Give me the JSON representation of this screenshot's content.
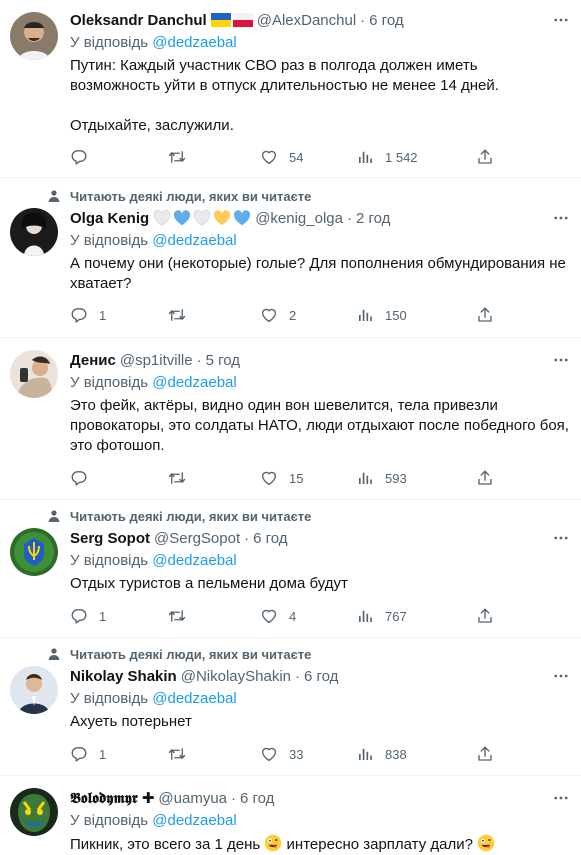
{
  "colors": {
    "accent": "#1d9bf0",
    "muted": "#536471",
    "text": "#0f1419",
    "divider": "#eff3f4"
  },
  "tweets": [
    {
      "name": "Oleksandr Danchul",
      "handle": "@AlexDanchul",
      "dot": "·",
      "time": "6 год",
      "reply_prefix": "У відповідь",
      "reply_to": "@dedzaebal",
      "text_lines": [
        "Путин: Каждый участник СВО раз в полгода должен иметь возможность уйти в отпуск длительностью не менее 14 дней.",
        "Отдыхайте, заслужили."
      ],
      "replies": "",
      "retweets": "",
      "likes": "54",
      "views": "1 542",
      "flair": [
        "ukraine-flag-icon",
        "poland-flag-icon"
      ]
    },
    {
      "social_context": "Читають деякі люди, яких ви читаєте",
      "name": "Olga Kenig",
      "handle": "@kenig_olga",
      "dot": "·",
      "time": "2 год",
      "reply_prefix": "У відповідь",
      "reply_to": "@dedzaebal",
      "text_lines": [
        "А почему они (некоторые) голые? Для пополнения обмундирования не хватает?"
      ],
      "replies": "1",
      "retweets": "",
      "likes": "2",
      "views": "150",
      "flair": [
        "white-heart-icon",
        "blue-heart-icon",
        "white-heart-icon",
        "yellow-heart-icon",
        "blue-heart-icon"
      ]
    },
    {
      "name": "Денис",
      "handle": "@sp1itville",
      "dot": "·",
      "time": "5 год",
      "reply_prefix": "У відповідь",
      "reply_to": "@dedzaebal",
      "text_lines": [
        "Это фейк, актёры, видно один вон шевелится, тела привезли провокаторы, это солдаты НАТО, люди отдыхают после победного боя, это фотошоп."
      ],
      "replies": "",
      "retweets": "",
      "likes": "15",
      "views": "593"
    },
    {
      "social_context": "Читають деякі люди, яких ви читаєте",
      "name": "Serg Sopot",
      "handle": "@SergSopot",
      "dot": "·",
      "time": "6 год",
      "reply_prefix": "У відповідь",
      "reply_to": "@dedzaebal",
      "text_lines": [
        "Отдых туристов а пельмени дома будут"
      ],
      "replies": "1",
      "retweets": "",
      "likes": "4",
      "views": "767"
    },
    {
      "social_context": "Читають деякі люди, яких ви читаєте",
      "name": "Nikolay Shakin",
      "handle": "@NikolayShakin",
      "dot": "·",
      "time": "6 год",
      "reply_prefix": "У відповідь",
      "reply_to": "@dedzaebal",
      "text_lines": [
        "Ахуеть потерьнет"
      ],
      "replies": "1",
      "retweets": "",
      "likes": "33",
      "views": "838"
    },
    {
      "name": "𝕭𝖔𝖑𝖔𝖉𝖞𝖒𝖞𝖗 ✚",
      "handle": "@uamyua",
      "dot": "·",
      "time": "6 год",
      "reply_prefix": "У відповідь",
      "reply_to": "@dedzaebal",
      "text_a": "Пикник, это всего за 1 день",
      "text_b": "интересно зарплату дали?",
      "emoji": "zany-face-icon"
    }
  ]
}
